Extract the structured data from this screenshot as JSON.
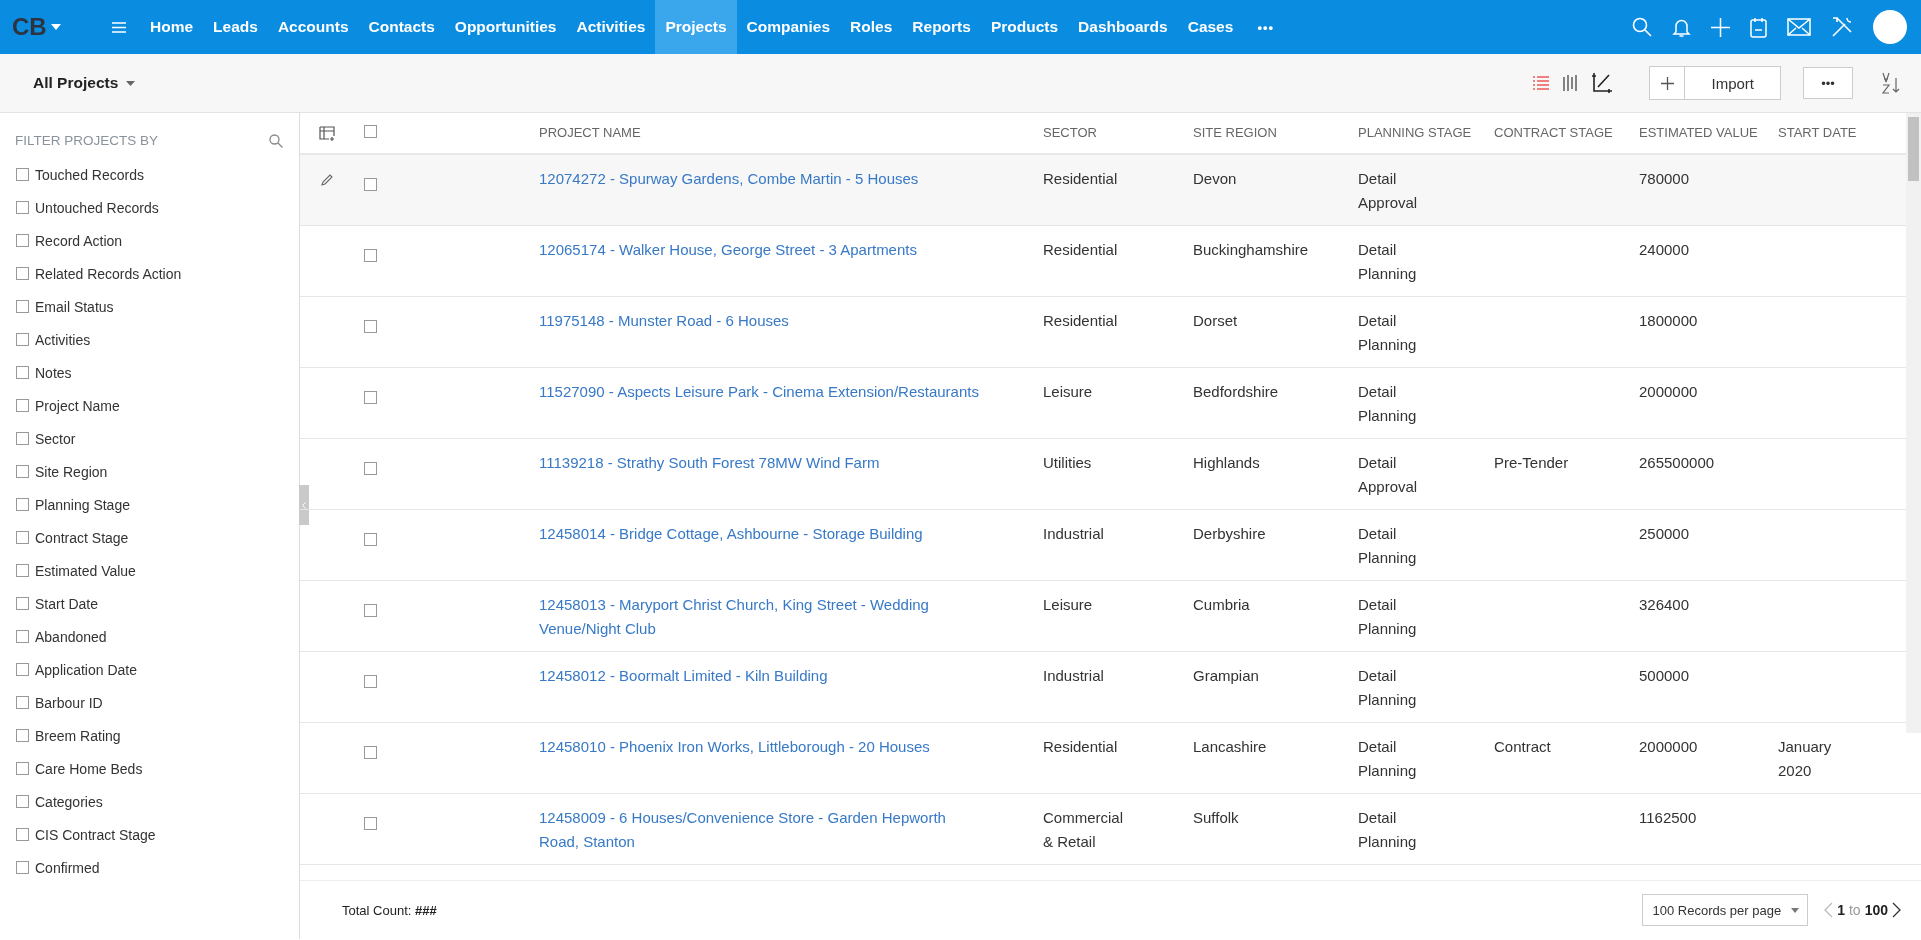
{
  "nav": {
    "logo": "CB",
    "items": [
      {
        "label": "Home",
        "selected": false
      },
      {
        "label": "Leads",
        "selected": false
      },
      {
        "label": "Accounts",
        "selected": false
      },
      {
        "label": "Contacts",
        "selected": false
      },
      {
        "label": "Opportunities",
        "selected": false
      },
      {
        "label": "Activities",
        "selected": false
      },
      {
        "label": "Projects",
        "selected": true
      },
      {
        "label": "Companies",
        "selected": false
      },
      {
        "label": "Roles",
        "selected": false
      },
      {
        "label": "Reports",
        "selected": false
      },
      {
        "label": "Products",
        "selected": false
      },
      {
        "label": "Dashboards",
        "selected": false
      },
      {
        "label": "Cases",
        "selected": false
      }
    ],
    "more": "•••"
  },
  "toolbar": {
    "view": "All Projects",
    "import": "Import",
    "more": "•••"
  },
  "filter": {
    "title": "FILTER PROJECTS BY",
    "items": [
      {
        "label": "Touched Records",
        "checked": false
      },
      {
        "label": "Untouched Records",
        "checked": false
      },
      {
        "label": "Record Action",
        "checked": false
      },
      {
        "label": "Related Records Action",
        "checked": false
      },
      {
        "label": "Email Status",
        "checked": false
      },
      {
        "label": "Activities",
        "checked": false
      },
      {
        "label": "Notes",
        "checked": false
      },
      {
        "label": "Project Name",
        "checked": false
      },
      {
        "label": "Sector",
        "checked": false
      },
      {
        "label": "Site Region",
        "checked": false
      },
      {
        "label": "Planning Stage",
        "checked": false
      },
      {
        "label": "Contract Stage",
        "checked": false
      },
      {
        "label": "Estimated Value",
        "checked": false
      },
      {
        "label": "Start Date",
        "checked": false
      },
      {
        "label": "Abandoned",
        "checked": false
      },
      {
        "label": "Application Date",
        "checked": false
      },
      {
        "label": "Barbour ID",
        "checked": false
      },
      {
        "label": "Breem Rating",
        "checked": false
      },
      {
        "label": "Care Home Beds",
        "checked": false
      },
      {
        "label": "Categories",
        "checked": false
      },
      {
        "label": "CIS Contract Stage",
        "checked": false
      },
      {
        "label": "Confirmed",
        "checked": false
      }
    ]
  },
  "table": {
    "all_checked": false,
    "columns": [
      "PROJECT NAME",
      "SECTOR",
      "SITE REGION",
      "PLANNING STAGE",
      "CONTRACT STAGE",
      "ESTIMATED VALUE",
      "START DATE"
    ],
    "rows": [
      {
        "hovered": true,
        "checked": false,
        "cells": [
          "12074272 - Spurway Gardens, Combe Martin - 5 Houses",
          "Residential",
          "Devon",
          "Detail Approval",
          "",
          "780000",
          ""
        ]
      },
      {
        "hovered": false,
        "checked": false,
        "cells": [
          "12065174 - Walker House, George Street - 3 Apartments",
          "Residential",
          "Buckinghamshire",
          "Detail Planning",
          "",
          "240000",
          ""
        ]
      },
      {
        "hovered": false,
        "checked": false,
        "cells": [
          "11975148 - Munster Road - 6 Houses",
          "Residential",
          "Dorset",
          "Detail Planning",
          "",
          "1800000",
          ""
        ]
      },
      {
        "hovered": false,
        "checked": false,
        "cells": [
          "11527090 - Aspects Leisure Park - Cinema Extension/Restaurants",
          "Leisure",
          "Bedfordshire",
          "Detail Planning",
          "",
          "2000000",
          ""
        ]
      },
      {
        "hovered": false,
        "checked": false,
        "cells": [
          "11139218 - Strathy South Forest 78MW Wind Farm",
          "Utilities",
          "Highlands",
          "Detail Approval",
          "Pre-Tender",
          "265500000",
          ""
        ]
      },
      {
        "hovered": false,
        "checked": false,
        "cells": [
          "12458014 - Bridge Cottage, Ashbourne - Storage Building",
          "Industrial",
          "Derbyshire",
          "Detail Planning",
          "",
          "250000",
          ""
        ]
      },
      {
        "hovered": false,
        "checked": false,
        "cells": [
          "12458013 - Maryport Christ Church, King Street - Wedding Venue/Night Club",
          "Leisure",
          "Cumbria",
          "Detail Planning",
          "",
          "326400",
          ""
        ]
      },
      {
        "hovered": false,
        "checked": false,
        "cells": [
          "12458012 - Boormalt Limited - Kiln Building",
          "Industrial",
          "Grampian",
          "Detail Planning",
          "",
          "500000",
          ""
        ]
      },
      {
        "hovered": false,
        "checked": false,
        "cells": [
          "12458010 - Phoenix Iron Works, Littleborough - 20 Houses",
          "Residential",
          "Lancashire",
          "Detail Planning",
          "Contract",
          "2000000",
          "January 2020"
        ]
      },
      {
        "hovered": false,
        "checked": false,
        "cells": [
          "12458009 - 6 Houses/Convenience Store - Garden Hepworth Road, Stanton",
          "Commercial & Retail",
          "Suffolk",
          "Detail Planning",
          "",
          "1162500",
          ""
        ]
      }
    ]
  },
  "footer": {
    "total": "Total Count: **###**",
    "per_page": "100 Records per page",
    "from": "1",
    "to": "to",
    "until": "100"
  }
}
